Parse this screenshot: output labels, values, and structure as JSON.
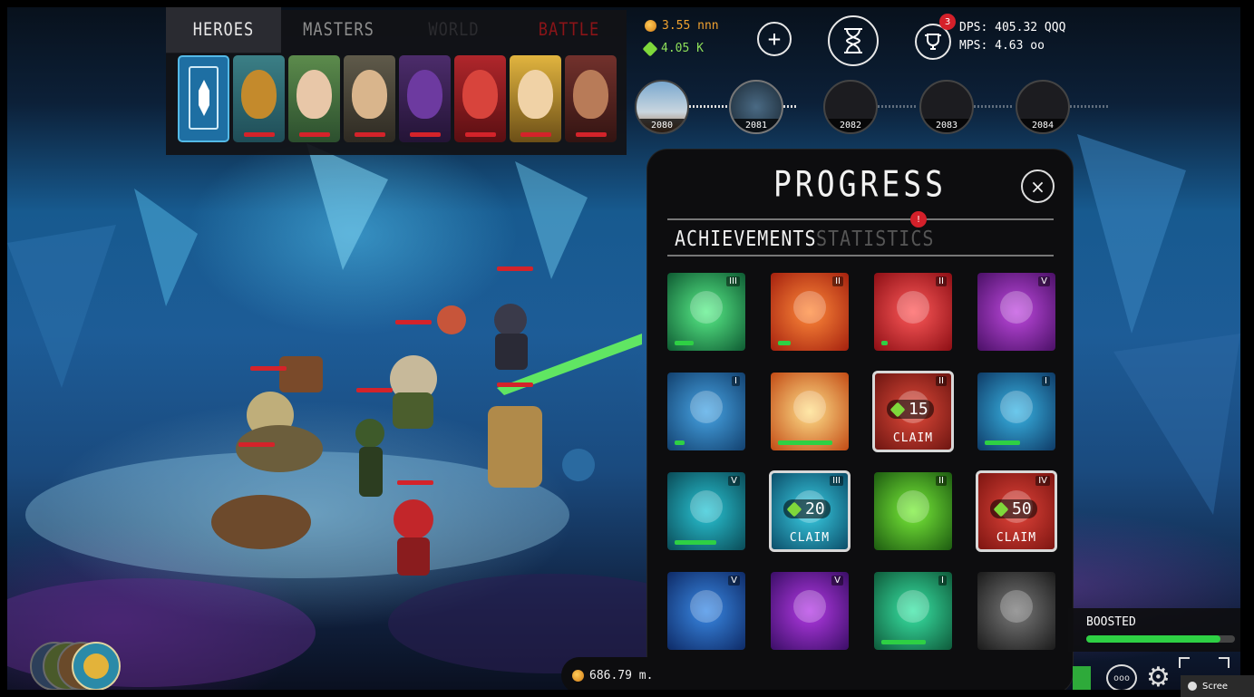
{
  "top_tabs": [
    {
      "label": "HEROES",
      "state": "active"
    },
    {
      "label": "MASTERS",
      "state": "inactive"
    },
    {
      "label": "WORLD",
      "state": "locked"
    },
    {
      "label": "BATTLE",
      "state": "alert"
    }
  ],
  "heroes": [
    {
      "name": "crystal-hero",
      "color": "#1e6fa3"
    },
    {
      "name": "golem-hero",
      "color": "#c48a2c"
    },
    {
      "name": "elf-hero",
      "color": "#5c8b4c"
    },
    {
      "name": "dwarf-hero",
      "color": "#5f5a4a"
    },
    {
      "name": "ninja-hero",
      "color": "#4c2c6b"
    },
    {
      "name": "fire-hero",
      "color": "#b0262b"
    },
    {
      "name": "jester-hero",
      "color": "#e1b43f"
    },
    {
      "name": "engineer-hero",
      "color": "#72312c"
    }
  ],
  "currency": {
    "gold": "3.55 nnn",
    "gems": "4.05 K"
  },
  "stats": {
    "dps": "DPS: 405.32 QQQ",
    "mps": "MPS: 4.63 oo",
    "trophy_badge": "3"
  },
  "levels": [
    "2080",
    "2081",
    "2082",
    "2083",
    "2084"
  ],
  "progress": {
    "title": "PROGRESS",
    "close_icon": "×",
    "tab_achievements": "ACHIEVEMENTS",
    "tab_statistics": "STATISTICS",
    "stats_badge": "!",
    "achievements": [
      {
        "icon": "swirl-up-icon",
        "roman": "III",
        "progress": 0.3
      },
      {
        "icon": "skull-swords-icon",
        "roman": "II",
        "progress": 0.2
      },
      {
        "icon": "demon-skull-icon",
        "roman": "II",
        "progress": 0.1
      },
      {
        "icon": "padlock-runner-icon",
        "roman": "V",
        "progress": 0
      },
      {
        "icon": "gift-dwarf-icon",
        "roman": "I",
        "progress": 0.15
      },
      {
        "icon": "sword-burst-icon",
        "roman": "",
        "progress": 0.85
      },
      {
        "icon": "fist-claim-icon",
        "roman": "II",
        "progress": 1,
        "claim_amount": "15",
        "claim_label": "CLAIM"
      },
      {
        "icon": "treasure-chest-icon",
        "roman": "I",
        "progress": 0.55
      },
      {
        "icon": "scroll-icon",
        "roman": "V",
        "progress": 0.65
      },
      {
        "icon": "coin-hand-icon",
        "roman": "III",
        "progress": 1,
        "claim_amount": "20",
        "claim_label": "CLAIM"
      },
      {
        "icon": "knight-helmet-icon",
        "roman": "II",
        "progress": 0
      },
      {
        "icon": "cannon-icon",
        "roman": "IV",
        "progress": 1,
        "claim_amount": "50",
        "claim_label": "CLAIM"
      },
      {
        "icon": "spellbook-icon",
        "roman": "V",
        "progress": 0
      },
      {
        "icon": "magic-orb-icon",
        "roman": "V",
        "progress": 0
      },
      {
        "icon": "spiral-icon",
        "roman": "I",
        "progress": 0.7
      },
      {
        "icon": "pointing-hand-icon",
        "roman": "",
        "progress": 0
      }
    ]
  },
  "footer": {
    "gold_amount": "686.79 m.",
    "boosted_label": "BOOSTED",
    "boost_progress": 0.9,
    "chat_glyph": "ooo",
    "gear_glyph": "⚙",
    "screen_label": "Scree"
  }
}
